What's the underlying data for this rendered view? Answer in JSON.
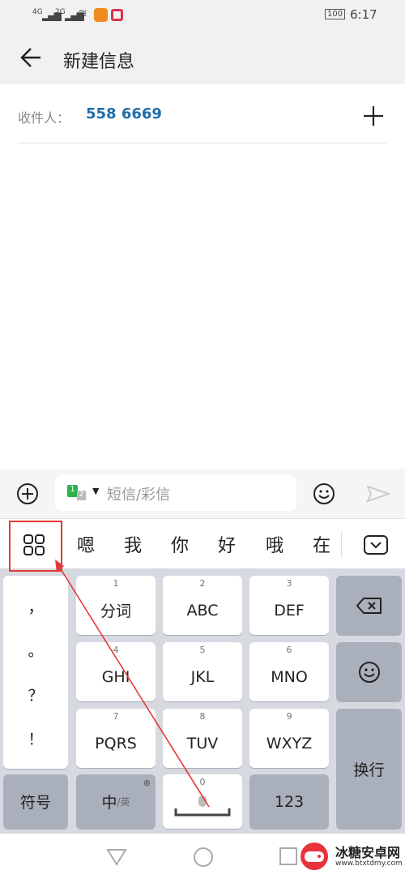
{
  "status": {
    "signal1": "4G",
    "signal2": "2G",
    "battery": "100",
    "time": "6:17"
  },
  "appbar": {
    "title": "新建信息"
  },
  "recipient": {
    "label": "收件人：",
    "number": "558 6669"
  },
  "compose": {
    "sim_badge": "1",
    "sim_badge2": "2",
    "placeholder": "短信/彩信"
  },
  "candidates": [
    "嗯",
    "我",
    "你",
    "好",
    "哦",
    "在"
  ],
  "keyboard": {
    "punct": [
      "，",
      "。",
      "？",
      "！"
    ],
    "keys": [
      {
        "num": "1",
        "label": "分词"
      },
      {
        "num": "2",
        "label": "ABC"
      },
      {
        "num": "3",
        "label": "DEF"
      },
      {
        "num": "4",
        "label": "GHI"
      },
      {
        "num": "5",
        "label": "JKL"
      },
      {
        "num": "6",
        "label": "MNO"
      },
      {
        "num": "7",
        "label": "PQRS"
      },
      {
        "num": "8",
        "label": "TUV"
      },
      {
        "num": "9",
        "label": "WXYZ"
      }
    ],
    "symbols": "符号",
    "lang_main": "中",
    "lang_sub": "/英",
    "space_num": "0",
    "numbers": "123",
    "enter": "换行"
  },
  "watermark": {
    "name": "冰糖安卓网",
    "url": "www.btxtdmy.com"
  },
  "colors": {
    "accent": "#1f6ea8",
    "annotation": "#e53935",
    "keyboard_bg": "#d6d9e0"
  }
}
